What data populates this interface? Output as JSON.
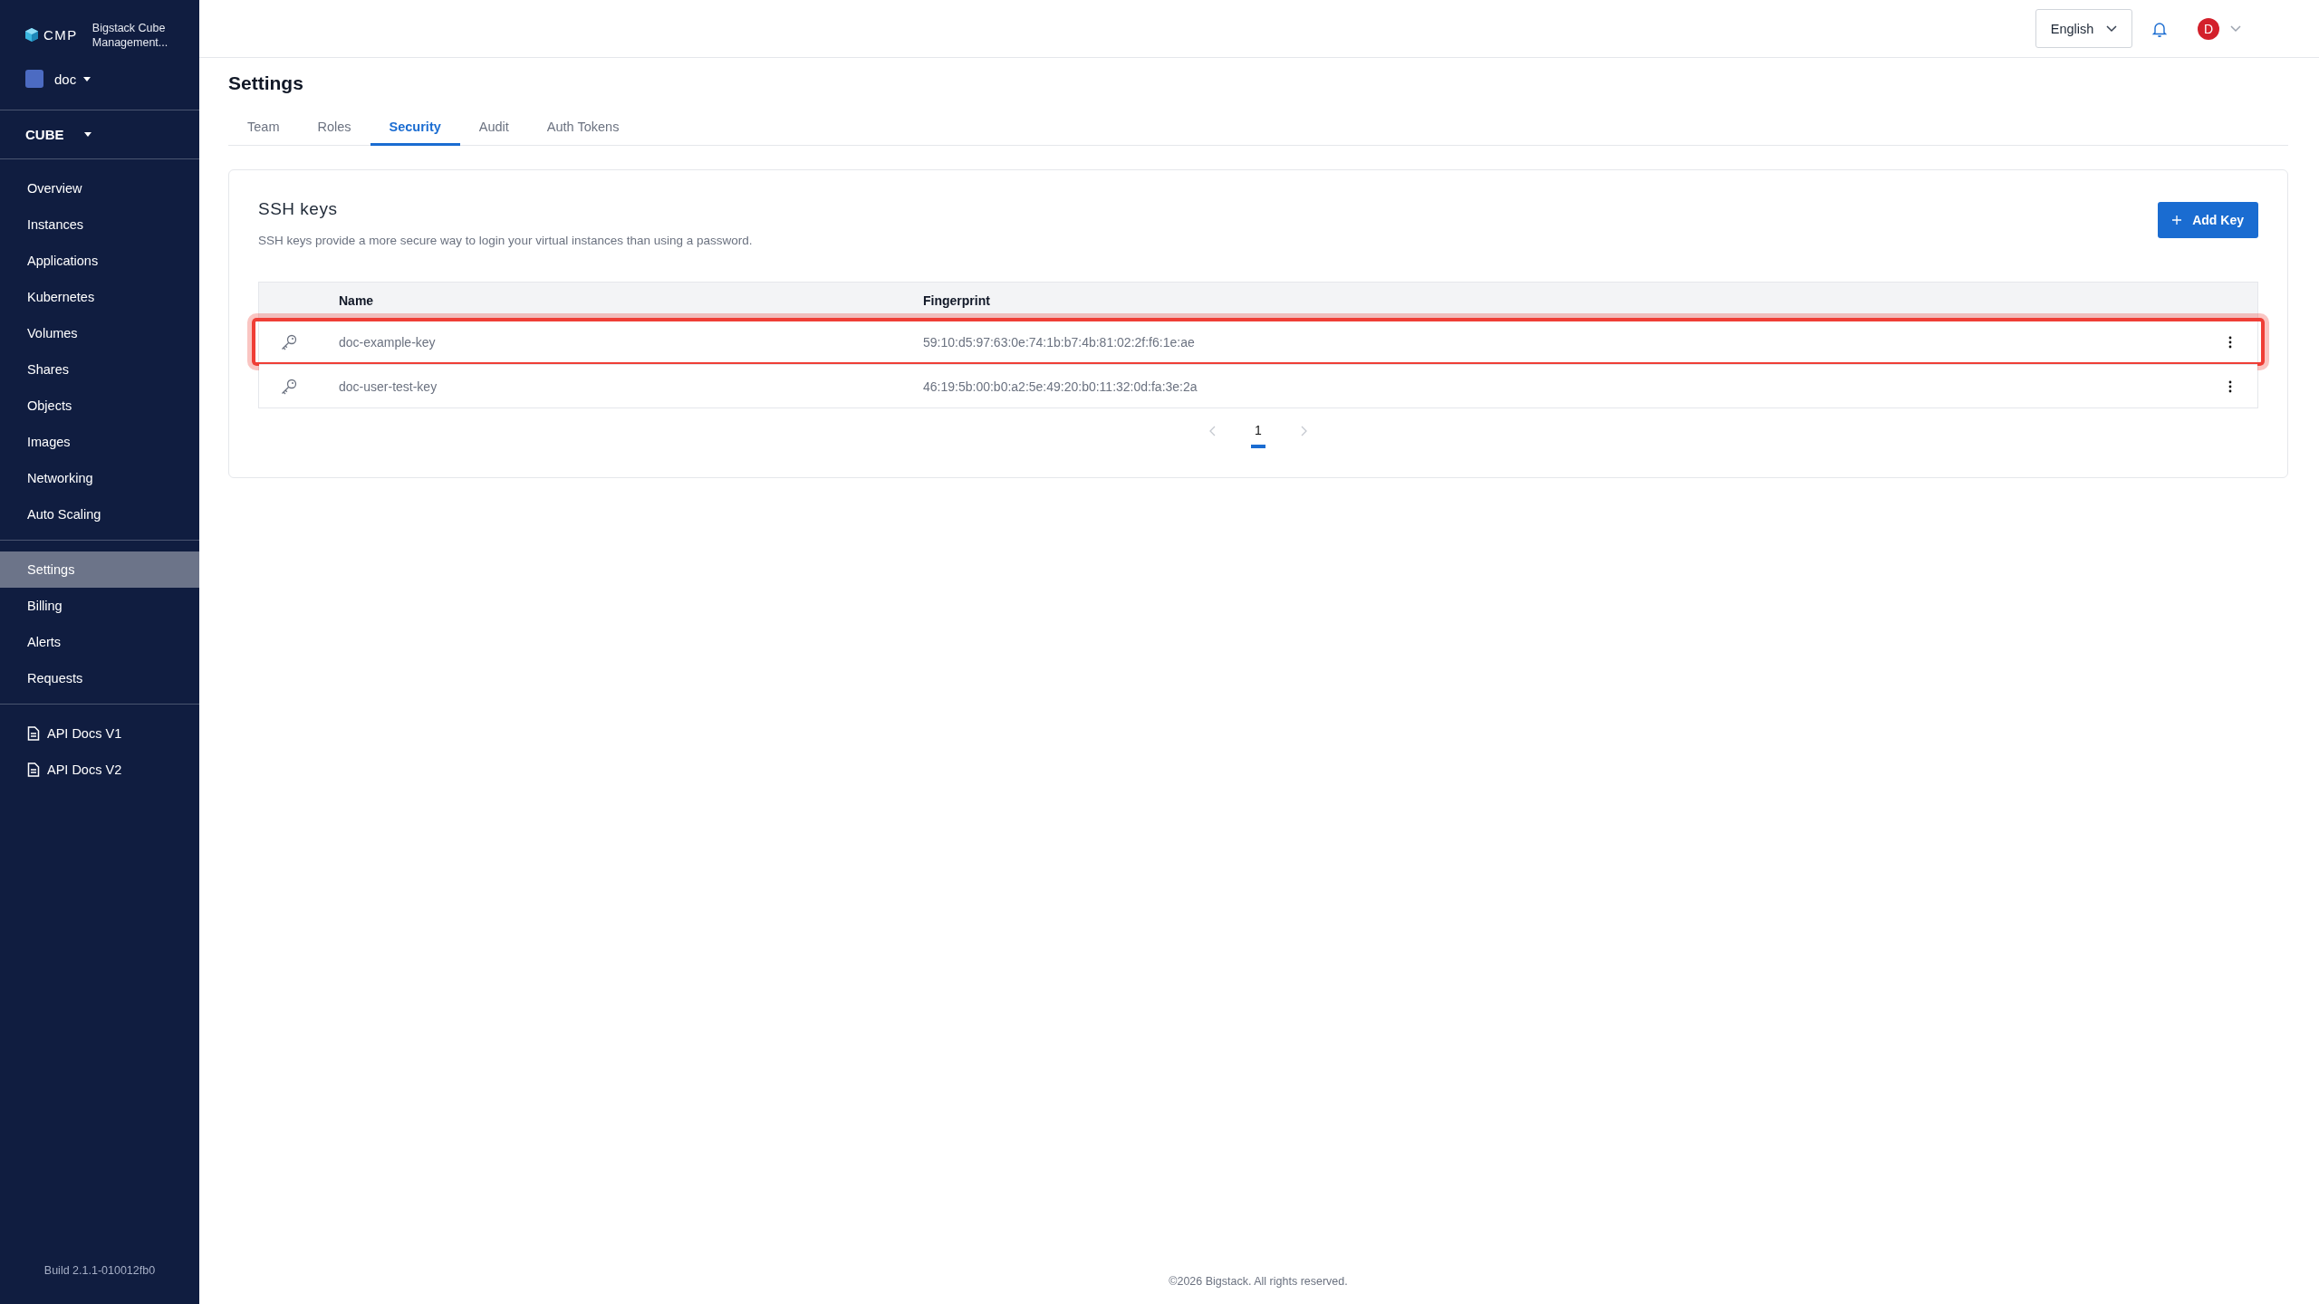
{
  "sidebar": {
    "brand": {
      "logo": "CMP",
      "product": "Bigstack Cube Management..."
    },
    "project": {
      "name": "doc"
    },
    "region": {
      "name": "CUBE"
    },
    "items": [
      {
        "label": "Overview",
        "selected": false
      },
      {
        "label": "Instances",
        "selected": false
      },
      {
        "label": "Applications",
        "selected": false
      },
      {
        "label": "Kubernetes",
        "selected": false
      },
      {
        "label": "Volumes",
        "selected": false
      },
      {
        "label": "Shares",
        "selected": false
      },
      {
        "label": "Objects",
        "selected": false
      },
      {
        "label": "Images",
        "selected": false
      },
      {
        "label": "Networking",
        "selected": false
      },
      {
        "label": "Auto Scaling",
        "selected": false
      }
    ],
    "account_items": [
      {
        "label": "Settings",
        "selected": true
      },
      {
        "label": "Billing",
        "selected": false
      },
      {
        "label": "Alerts",
        "selected": false
      },
      {
        "label": "Requests",
        "selected": false
      }
    ],
    "doc_links": [
      "API Docs V1",
      "API Docs V2"
    ],
    "build": "Build 2.1.1-010012fb0"
  },
  "header": {
    "language": "English",
    "avatar": "D"
  },
  "page_title": "Settings",
  "tabs": [
    {
      "label": "Team",
      "selected": false
    },
    {
      "label": "Roles",
      "selected": false
    },
    {
      "label": "Security",
      "selected": true
    },
    {
      "label": "Audit",
      "selected": false
    },
    {
      "label": "Auth Tokens",
      "selected": false
    }
  ],
  "card": {
    "title": "SSH keys",
    "description": "SSH keys provide a more secure way to login your virtual instances than using a password.",
    "add_button": "Add Key"
  },
  "table": {
    "columns": [
      "Name",
      "Fingerprint"
    ],
    "rows": [
      {
        "name": "doc-example-key",
        "fingerprint": "59:10:d5:97:63:0e:74:1b:b7:4b:81:02:2f:f6:1e:ae",
        "highlighted": true
      },
      {
        "name": "doc-user-test-key",
        "fingerprint": "46:19:5b:00:b0:a2:5e:49:20:b0:11:32:0d:fa:3e:2a",
        "highlighted": false
      }
    ]
  },
  "pagination": {
    "pages": [
      {
        "label": "1",
        "selected": true
      }
    ]
  },
  "footer": "©2026 Bigstack. All rights reserved."
}
